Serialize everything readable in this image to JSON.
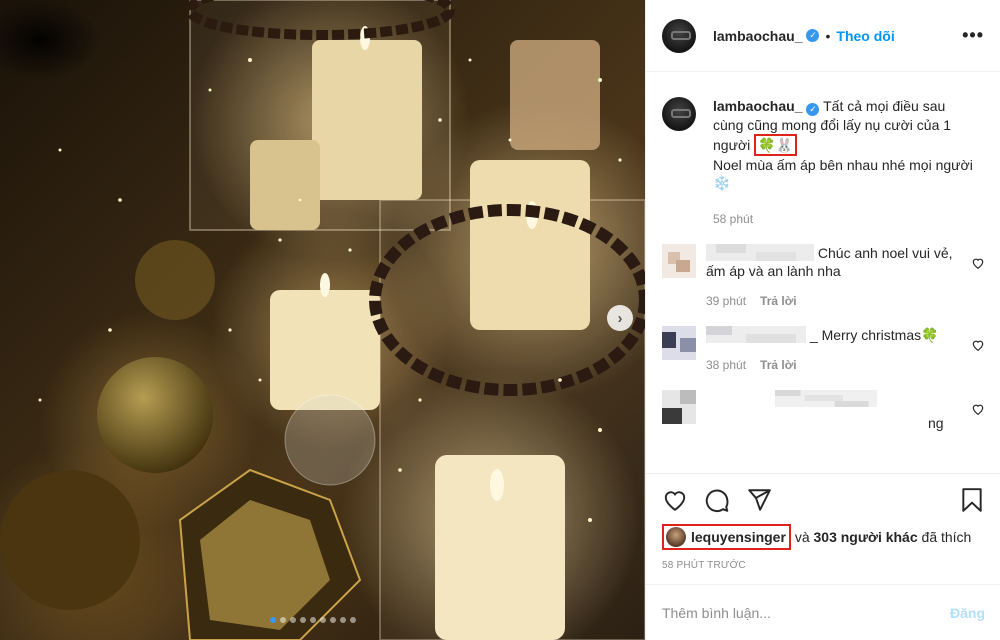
{
  "author": {
    "handle": "lambaochau_",
    "follow_label": "Theo dõi",
    "more_label": "•••"
  },
  "caption": {
    "line1": "Tất cả mọi điều sau cùng cũng mong đổi lấy nụ cười của 1 người",
    "emoji_clover": "🍀",
    "emoji_rabbit": "🐰",
    "line2": "Noel mùa ấm áp bên nhau nhé mọi người",
    "emoji_snow": "❄️",
    "time": "58 phút"
  },
  "comments": [
    {
      "text": "Chúc anh noel vui vẻ, ấm áp và an lành nha",
      "time": "39 phút",
      "reply": "Trả lời"
    },
    {
      "text": "_ Merry christmas",
      "emoji": "🍀",
      "time": "38 phút",
      "reply": "Trả lời"
    },
    {
      "text": "ng"
    }
  ],
  "likes": {
    "user": "lequyensinger",
    "connector": "và",
    "count_text": "303 người khác",
    "suffix": "đã thích"
  },
  "timestamp": "58 PHÚT TRƯỚC",
  "add_comment": {
    "placeholder": "Thêm bình luận...",
    "post_label": "Đăng"
  },
  "carousel": {
    "count": 9,
    "active_index": 0
  },
  "colors": {
    "accent": "#0095f6",
    "highlight_box": "#e0231a",
    "muted": "#8e8e8e"
  },
  "icons": [
    "verified-icon",
    "more-icon",
    "heart-icon",
    "comment-icon",
    "share-icon",
    "save-icon",
    "chevron-right-icon"
  ]
}
